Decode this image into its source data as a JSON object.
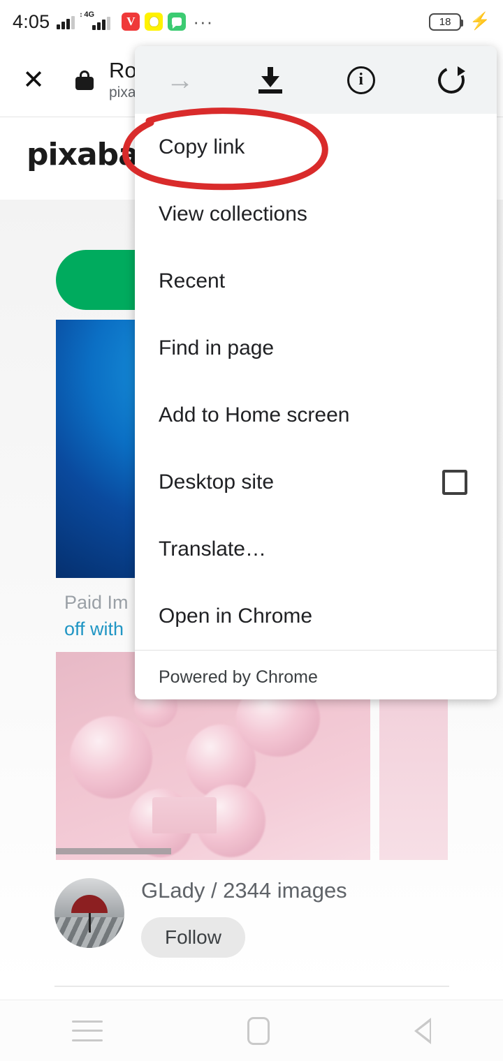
{
  "status_bar": {
    "time": "4:05",
    "network_label": "4G",
    "app_icons": [
      {
        "name": "vivaldi-icon",
        "glyph": "V"
      },
      {
        "name": "snapchat-icon",
        "glyph": ""
      },
      {
        "name": "messages-icon",
        "glyph": ""
      }
    ],
    "overflow": "···",
    "battery_level": "18",
    "charging_glyph": "⚡"
  },
  "custom_tab": {
    "close_label": "✕",
    "security_icon": "lock-icon",
    "title": "Ro",
    "subtitle": "pixa"
  },
  "page": {
    "logo_text": "pixabay",
    "paid_line_1": "Paid Im",
    "paid_line_2": "off with",
    "author_name": "GLady / 2344 images",
    "follow_label": "Follow"
  },
  "menu": {
    "toolbar": [
      {
        "name": "forward-icon",
        "label": "Forward",
        "enabled": false
      },
      {
        "name": "download-icon",
        "label": "Download",
        "enabled": true
      },
      {
        "name": "page-info-icon",
        "label": "Page info",
        "enabled": true
      },
      {
        "name": "reload-icon",
        "label": "Reload",
        "enabled": true
      }
    ],
    "items": [
      {
        "label": "Copy link",
        "has_checkbox": false
      },
      {
        "label": "View collections",
        "has_checkbox": false
      },
      {
        "label": "Recent",
        "has_checkbox": false
      },
      {
        "label": "Find in page",
        "has_checkbox": false
      },
      {
        "label": "Add to Home screen",
        "has_checkbox": false
      },
      {
        "label": "Desktop site",
        "has_checkbox": true,
        "checked": false
      },
      {
        "label": "Translate…",
        "has_checkbox": false
      },
      {
        "label": "Open in Chrome",
        "has_checkbox": false
      }
    ],
    "footer": "Powered by Chrome"
  },
  "annotation": {
    "type": "hand-drawn-ellipse",
    "color": "#d92b2b",
    "target_label": "Copy link"
  },
  "nav_bar": {
    "recents_label": "Recents",
    "home_label": "Home",
    "back_label": "Back"
  },
  "colors": {
    "accent_green": "#00ab5e",
    "link_blue": "#2196c4",
    "annotation_red": "#d92b2b",
    "menu_toolbar_bg": "#f1f3f4"
  }
}
